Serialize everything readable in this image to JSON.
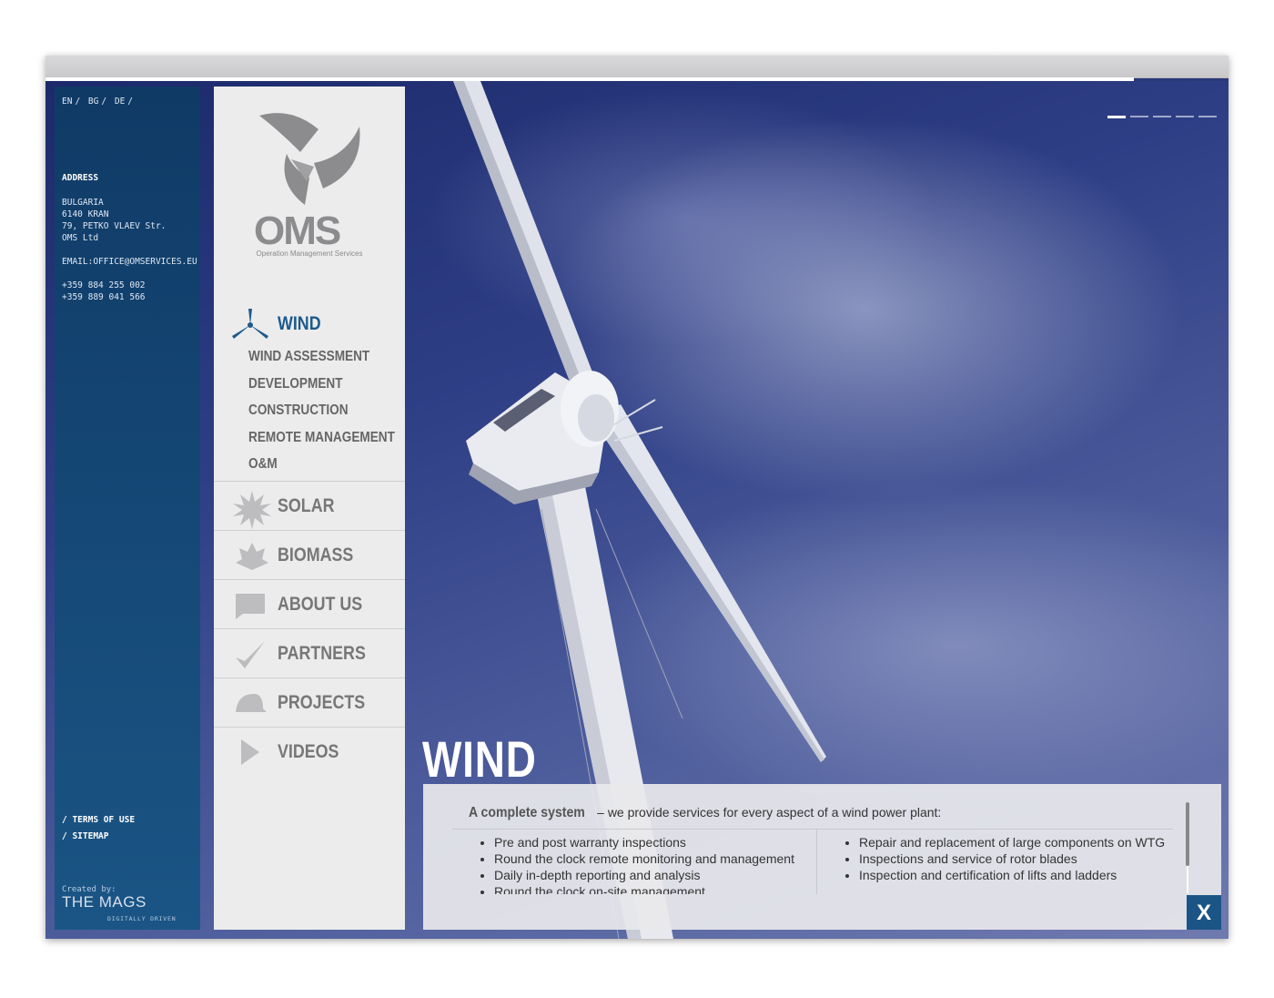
{
  "language_switch": [
    "EN",
    "BG",
    "DE"
  ],
  "contact": {
    "address_title": "ADDRESS",
    "address_lines": "BULGARIA\n6140 KRAN\n79, PETKO VLAEV Str.\nOMS Ltd",
    "email": "EMAIL:OFFICE@OMSERVICES.EU",
    "phone_1": "+359 884 255 002",
    "phone_2": "+359 889 041 566",
    "terms": "/ TERMS OF USE",
    "sitemap": "/ SITEMAP",
    "created_by": "Created by:",
    "agency": "THE MAGS",
    "agency_tagline": "DIGITALLY DRIVEN"
  },
  "logo": {
    "text": "OMS",
    "tagline": "Operation Management Services"
  },
  "nav": {
    "wind": "WIND",
    "wind_sub": [
      "WIND ASSESSMENT",
      "DEVELOPMENT",
      "CONSTRUCTION",
      "REMOTE MANAGEMENT",
      "O&M"
    ],
    "items": [
      {
        "label": "SOLAR",
        "icon": "sun-icon"
      },
      {
        "label": "BIOMASS",
        "icon": "leaf-icon"
      },
      {
        "label": "ABOUT US",
        "icon": "speech-bubble-icon"
      },
      {
        "label": "PARTNERS",
        "icon": "checkmark-icon"
      },
      {
        "label": "PROJECTS",
        "icon": "hard-hat-icon"
      },
      {
        "label": "VIDEOS",
        "icon": "play-icon"
      }
    ]
  },
  "main": {
    "title": "WIND",
    "intro_bold": "A complete system",
    "intro_rest": " – we provide services for every aspect of a wind power plant:",
    "list_left": [
      "Pre and post warranty inspections",
      "Round the clock remote monitoring and management",
      "Daily in-depth reporting and analysis",
      "Round the clock on-site management"
    ],
    "list_right": [
      "Repair and replacement of large components on WTG",
      "Inspections and service of rotor blades",
      "Inspection and certification of lifts and ladders"
    ],
    "close_label": "X"
  },
  "slides": {
    "count": 5,
    "active": 1
  },
  "page_progress": 0.92,
  "colors": {
    "accent": "#1a5585",
    "sidebar": "#103a66",
    "nav_bg": "#ececed",
    "wind_active": "#1d5a8c"
  }
}
